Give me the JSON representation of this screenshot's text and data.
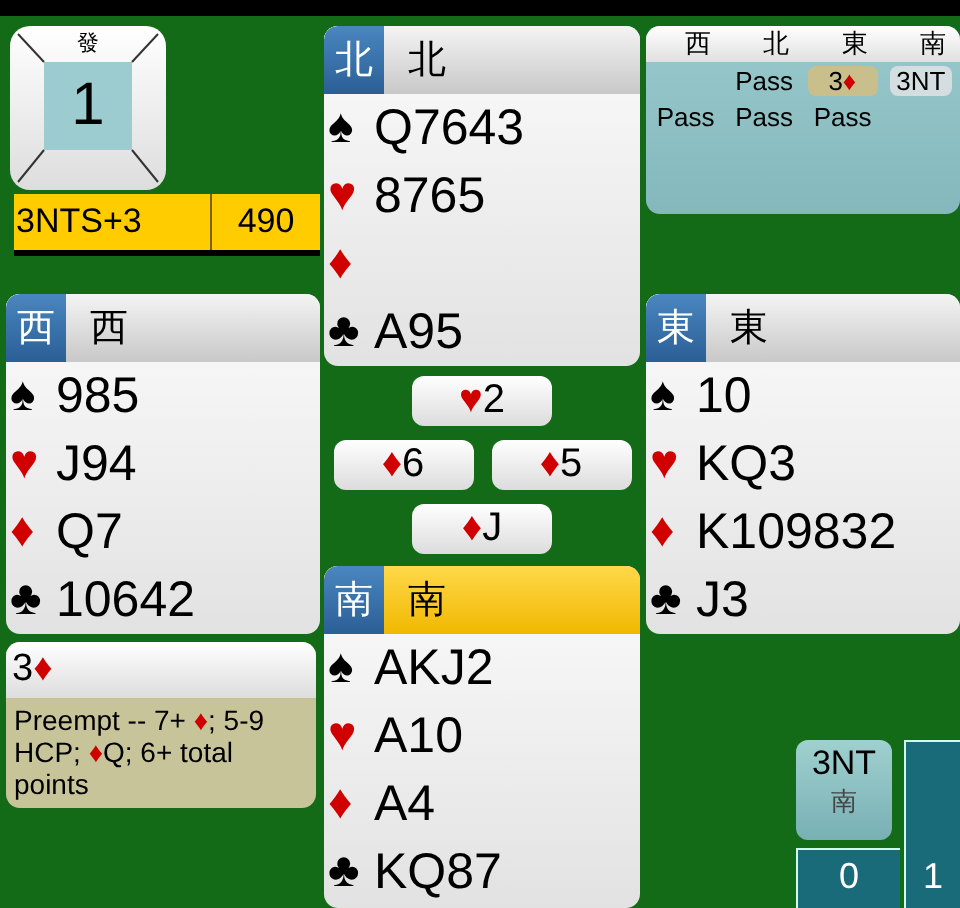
{
  "board": {
    "label": "發",
    "number": "1"
  },
  "result": {
    "contract": "3NTS+3",
    "score": "490"
  },
  "hands": {
    "north": {
      "badge": "北",
      "name": "北",
      "selected": false,
      "suits": [
        {
          "kind": "spade",
          "symbol": "♠",
          "cards": "Q7643"
        },
        {
          "kind": "heart",
          "symbol": "♥",
          "cards": "8765"
        },
        {
          "kind": "diamond",
          "symbol": "♦"
        },
        {
          "kind": "club",
          "symbol": "♣",
          "cards": "A95"
        }
      ]
    },
    "west": {
      "badge": "西",
      "name": "西",
      "selected": false,
      "suits": [
        {
          "kind": "spade",
          "symbol": "♠",
          "cards": "985"
        },
        {
          "kind": "heart",
          "symbol": "♥",
          "cards": "J94"
        },
        {
          "kind": "diamond",
          "symbol": "♦",
          "cards": "Q7"
        },
        {
          "kind": "club",
          "symbol": "♣",
          "cards": "10642"
        }
      ]
    },
    "east": {
      "badge": "東",
      "name": "東",
      "selected": false,
      "suits": [
        {
          "kind": "spade",
          "symbol": "♠",
          "cards": "10"
        },
        {
          "kind": "heart",
          "symbol": "♥",
          "cards": "KQ3"
        },
        {
          "kind": "diamond",
          "symbol": "♦",
          "cards": "K109832"
        },
        {
          "kind": "club",
          "symbol": "♣",
          "cards": "J3"
        }
      ]
    },
    "south": {
      "badge": "南",
      "name": "南",
      "selected": true,
      "suits": [
        {
          "kind": "spade",
          "symbol": "♠",
          "cards": "AKJ2"
        },
        {
          "kind": "heart",
          "symbol": "♥",
          "cards": "A10"
        },
        {
          "kind": "diamond",
          "symbol": "♦",
          "cards": "A4"
        },
        {
          "kind": "club",
          "symbol": "♣",
          "cards": "KQ87"
        }
      ]
    }
  },
  "trick": {
    "north": {
      "kind": "heart",
      "symbol": "♥",
      "rank": "2"
    },
    "west": {
      "kind": "diamond",
      "symbol": "♦",
      "rank": "6"
    },
    "east": {
      "kind": "diamond",
      "symbol": "♦",
      "rank": "5"
    },
    "south": {
      "kind": "diamond",
      "symbol": "♦",
      "rank": "J"
    }
  },
  "auction": {
    "headers": [
      "西",
      "北",
      "東",
      "南"
    ],
    "rows": [
      [
        null,
        {
          "kind": "plain",
          "text": "Pass"
        },
        {
          "kind": "alerted",
          "text": "3",
          "symbol": "♦"
        },
        {
          "kind": "contract",
          "text": "3NT"
        }
      ],
      [
        {
          "kind": "plain",
          "text": "Pass"
        },
        {
          "kind": "plain",
          "text": "Pass"
        },
        {
          "kind": "plain",
          "text": "Pass"
        },
        null
      ]
    ]
  },
  "explanation": {
    "bid": "3",
    "symbol": "♦",
    "segments": [
      {
        "kind": "text",
        "text": "Preempt -- 7+ "
      },
      {
        "kind": "diamond",
        "text": "♦"
      },
      {
        "kind": "text",
        "text": "; 5-9 HCP; "
      },
      {
        "kind": "diamond",
        "text": "♦"
      },
      {
        "kind": "text",
        "text": "Q; 6+ total points"
      }
    ]
  },
  "final_contract": {
    "contract": "3NT",
    "declarer": "南"
  },
  "tricks": {
    "ours": "0",
    "theirs": "1"
  }
}
